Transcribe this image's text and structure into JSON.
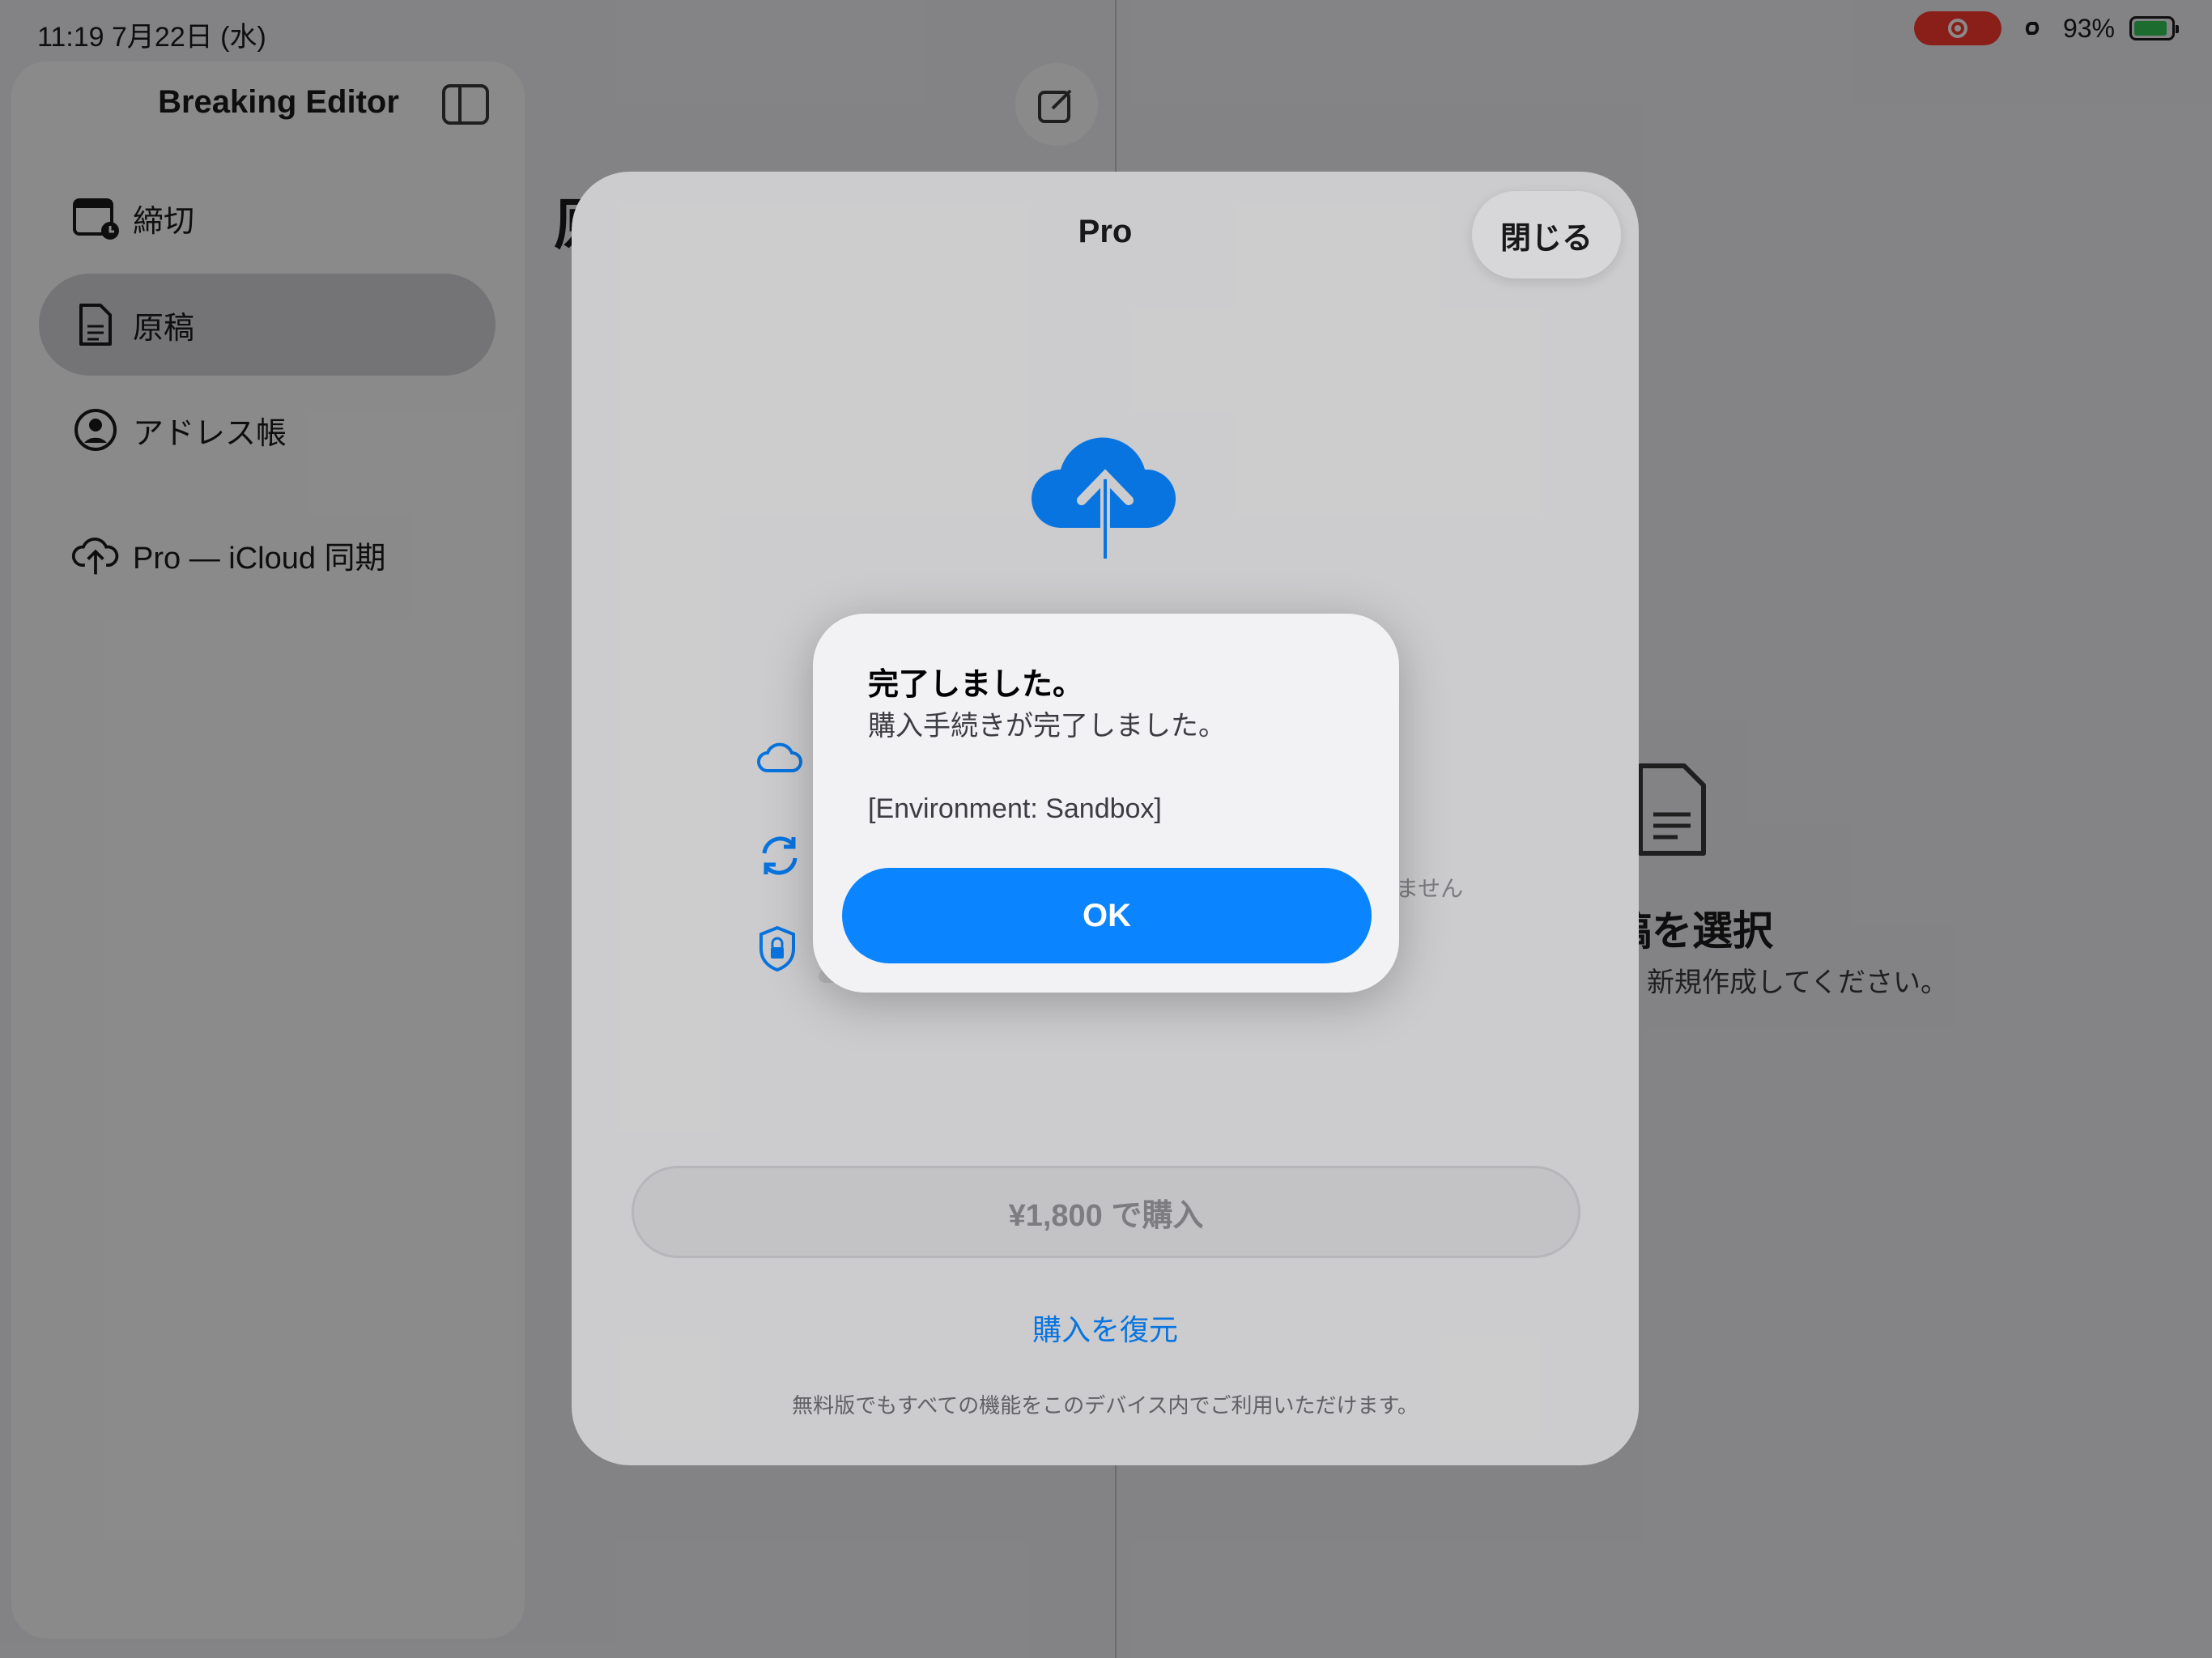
{
  "status_bar": {
    "time_date": "11:19   7月22日 (水)",
    "battery": "93%"
  },
  "sidebar": {
    "title": "Breaking Editor",
    "items": [
      {
        "label": "締切",
        "icon": "calendar-clock-icon"
      },
      {
        "label": "原稿",
        "icon": "document-icon",
        "selected": true
      },
      {
        "label": "アドレス帳",
        "icon": "person-circle-icon"
      },
      {
        "label": "Pro — iCloud 同期",
        "icon": "cloud-upload-icon"
      }
    ]
  },
  "detail": {
    "title_peek": "原",
    "empty_title": "稿を選択",
    "empty_subtitle": "、新規作成してください。"
  },
  "pro_sheet": {
    "title": "Pro",
    "close_label": "閉じる",
    "hidden_fragment": "ません",
    "buy_label": "¥1,800 で購入",
    "restore_label": "購入を復元",
    "footnote": "無料版でもすべての機能をこのデバイス内でご利用いただけます。"
  },
  "alert": {
    "title": "完了しました。",
    "message": "購入手続きが完了しました。",
    "environment": "[Environment: Sandbox]",
    "ok_label": "OK"
  },
  "colors": {
    "accent": "#0a84ff",
    "record": "#ff3b30",
    "battery": "#34c759"
  }
}
